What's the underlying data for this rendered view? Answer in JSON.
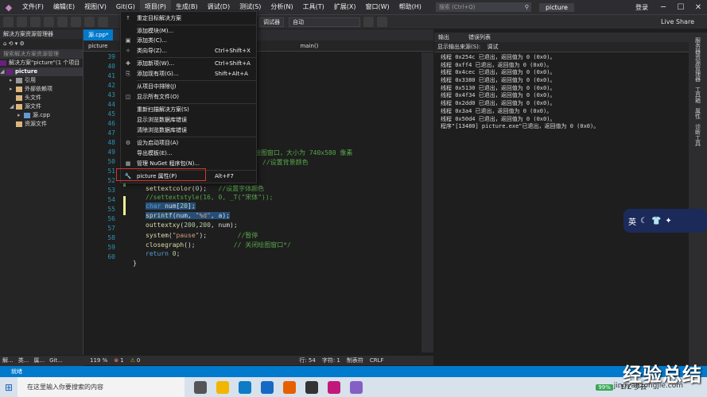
{
  "menubar": {
    "items": [
      "文件(F)",
      "编辑(E)",
      "视图(V)",
      "Git(G)",
      "项目(P)",
      "生成(B)",
      "调试(D)",
      "测试(S)",
      "分析(N)",
      "工具(T)",
      "扩展(X)",
      "窗口(W)",
      "帮助(H)"
    ],
    "search_placeholder": "搜索 (Ctrl+Q)",
    "solution_name": "picture",
    "login": "登录"
  },
  "toolbar": {
    "debugger_combo": "调试器",
    "config_combo": "自动",
    "liveshare": "Live Share"
  },
  "solution_explorer": {
    "title": "解决方案资源管理器",
    "search_placeholder": "搜索解决方案资源管理",
    "solution_row": "解决方案\"picture\"(1 个项目",
    "project": "picture",
    "nodes": [
      "引用",
      "外部依赖项",
      "头文件",
      "源文件",
      "源.cpp",
      "资源文件"
    ]
  },
  "editor": {
    "tab_label": "源.cpp*",
    "nav_project": "picture",
    "nav_function": "main()",
    "line_numbers": [
      "39",
      "40",
      "41",
      "42",
      "43",
      "44",
      "45",
      "46",
      "47",
      "48",
      "49",
      "50",
      "51",
      "52",
      "53",
      "54",
      "55",
      "56",
      "57",
      "58",
      "59",
      "60"
    ],
    "code_48": "绘图窗口，大小为 740x580 像素",
    "code_49": "//设置背景颜色",
    "zoom": "119 %",
    "errors": "1",
    "warnings": "0",
    "row": "行: 54",
    "col": "字符: 1",
    "tabs_mode": "制表符",
    "eol": "CRLF"
  },
  "context_menu": {
    "items": [
      {
        "label": "重定目标解决方案",
        "key": "",
        "icon": "up-arrow-icon"
      },
      {
        "label": "添加模块(M)...",
        "key": "",
        "icon": ""
      },
      {
        "label": "添加类(C)...",
        "key": "",
        "icon": "class-icon"
      },
      {
        "label": "类向导(Z)...",
        "key": "Ctrl+Shift+X",
        "icon": "wizard-icon"
      },
      {
        "label": "添加新项(W)...",
        "key": "Ctrl+Shift+A",
        "icon": "new-item-icon"
      },
      {
        "label": "添加现有项(G)...",
        "key": "Shift+Alt+A",
        "icon": "existing-item-icon"
      },
      {
        "label": "从项目中排除(J)",
        "key": "",
        "icon": ""
      },
      {
        "label": "显示所有文件(O)",
        "key": "",
        "icon": "show-all-icon"
      },
      {
        "label": "重新扫描解决方案(S)",
        "key": "",
        "icon": ""
      },
      {
        "label": "显示浏览数据库错误",
        "key": "",
        "icon": ""
      },
      {
        "label": "清除浏览数据库错误",
        "key": "",
        "icon": ""
      },
      {
        "label": "设为启动项目(A)",
        "key": "",
        "icon": "gear-icon"
      },
      {
        "label": "导出模板(E)...",
        "key": "",
        "icon": ""
      },
      {
        "label": "管理 NuGet 程序包(N)...",
        "key": "",
        "icon": "nuget-icon"
      },
      {
        "label": "picture 属性(P)",
        "key": "Alt+F7",
        "icon": "wrench-icon"
      }
    ]
  },
  "output": {
    "tabs": [
      "输出",
      "错误列表"
    ],
    "source_label": "显示输出来源(S):",
    "source_value": "调试",
    "lines": [
      "线程 0x254c 已退出，返回值为 0 (0x0)。",
      "线程 0xff4 已退出，返回值为 0 (0x0)。",
      "线程 0x4cec 已退出，返回值为 0 (0x0)。",
      "线程 0x3380 已退出，返回值为 0 (0x0)。",
      "线程 0x5130 已退出，返回值为 0 (0x0)。",
      "线程 0x4f34 已退出，返回值为 0 (0x0)。",
      "线程 0x2dd0 已退出，返回值为 0 (0x0)。",
      "线程 0x3a4 已退出，返回值为 0 (0x0)。",
      "线程 0x50d4 已退出，返回值为 0 (0x0)。",
      "程序\"[13480] picture.exe\"已退出，返回值为 0 (0x0)。"
    ],
    "right_tabs": [
      "服务器资源管理器",
      "工具箱",
      "属性",
      "诊断工具"
    ]
  },
  "bottom_tabs": [
    "解...",
    "类...",
    "属...",
    "Git..."
  ],
  "statusbar": {
    "text": "就绪"
  },
  "taskbar": {
    "search_placeholder": "在这里输入你要搜索的内容",
    "battery": "99%",
    "weather": "-1°C 多云",
    "date": "2022/1/9"
  },
  "ime": {
    "label": "英"
  },
  "watermark": {
    "title": "经验总结",
    "url": "jingyanzongjie.com"
  }
}
